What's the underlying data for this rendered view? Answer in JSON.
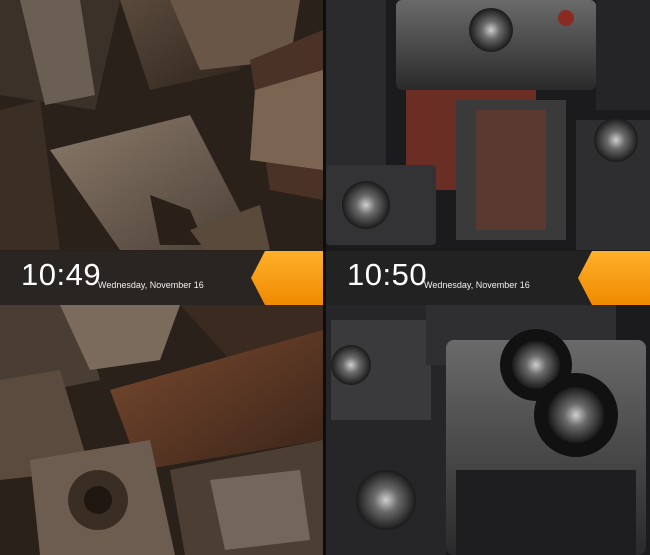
{
  "screens": [
    {
      "time": "10:49",
      "date": "Wednesday, November 16",
      "wallpaper": "letterpress-type-blocks",
      "unlock_icon": "orange-arrow-unlock-handle"
    },
    {
      "time": "10:50",
      "date": "Wednesday, November 16",
      "wallpaper": "vintage-cameras",
      "unlock_icon": "orange-arrow-unlock-handle"
    }
  ],
  "colors": {
    "accent_orange": "#f79a12",
    "accent_orange_dark": "#e07f00",
    "bar_overlay": "#2a2624"
  }
}
